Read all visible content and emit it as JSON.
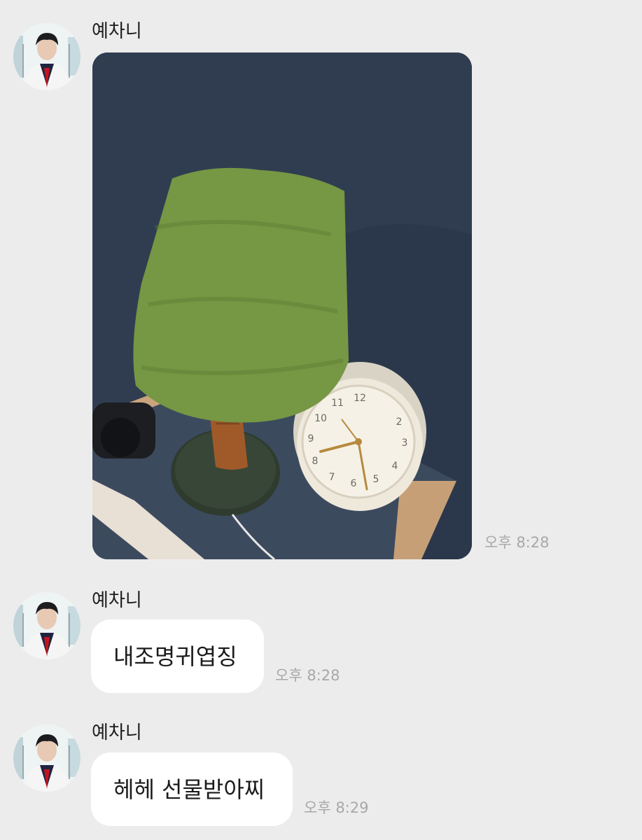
{
  "colors": {
    "background": "#ececec",
    "bubble": "#ffffff",
    "timestamp": "#a8a8a8",
    "text": "#1b1b1b"
  },
  "messages": [
    {
      "sender": "예차니",
      "type": "image",
      "image_alt": "tree-shaped knitted lamp with alarm clock photo",
      "time": "오후 8:28"
    },
    {
      "sender": "예차니",
      "type": "text",
      "text": "내조명귀엽징",
      "time": "오후 8:28"
    },
    {
      "sender": "예차니",
      "type": "text",
      "text": "헤헤 선물받아찌",
      "time": "오후 8:29"
    }
  ]
}
